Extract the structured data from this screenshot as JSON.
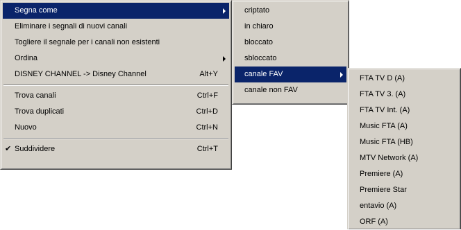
{
  "menu1": {
    "items": [
      {
        "label": "Segna come",
        "shortcut": "",
        "submenu": true
      },
      {
        "label": "Eliminare i segnali di nuovi canali",
        "shortcut": ""
      },
      {
        "label": "Togliere il segnale per i canali non esistenti",
        "shortcut": ""
      },
      {
        "label": "Ordina",
        "shortcut": "",
        "submenu": true
      },
      {
        "label": "DISNEY CHANNEL -> Disney Channel",
        "shortcut": "Alt+Y"
      },
      {
        "label": "Trova canali",
        "shortcut": "Ctrl+F"
      },
      {
        "label": "Trova duplicati",
        "shortcut": "Ctrl+D"
      },
      {
        "label": "Nuovo",
        "shortcut": "Ctrl+N"
      },
      {
        "label": "Suddividere",
        "shortcut": "Ctrl+T",
        "checked": true,
        "check_glyph": "✔"
      }
    ]
  },
  "menu2": {
    "items": [
      {
        "label": "criptato"
      },
      {
        "label": "in chiaro"
      },
      {
        "label": "bloccato"
      },
      {
        "label": "sbloccato"
      },
      {
        "label": "canale FAV",
        "submenu": true
      },
      {
        "label": "canale non FAV"
      }
    ]
  },
  "menu3": {
    "items": [
      {
        "label": "FTA TV D (A)"
      },
      {
        "label": "FTA TV 3. (A)"
      },
      {
        "label": "FTA TV Int. (A)"
      },
      {
        "label": "Music FTA (A)"
      },
      {
        "label": "Music FTA (HB)"
      },
      {
        "label": "MTV Network (A)"
      },
      {
        "label": "Premiere (A)"
      },
      {
        "label": "Premiere Star"
      },
      {
        "label": "entavio (A)"
      },
      {
        "label": "ORF (A)"
      }
    ]
  },
  "colors": {
    "menu_face": "#d4d0c8",
    "highlight": "#0a246a",
    "highlight_text": "#ffffff"
  }
}
